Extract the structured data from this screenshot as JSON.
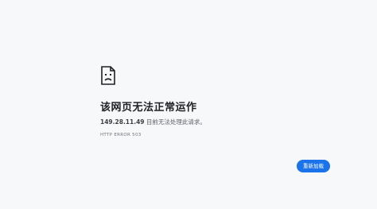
{
  "error_page": {
    "icon": "sad-document-icon",
    "title": "该网页无法正常运作",
    "host": "149.28.11.49",
    "message": " 目前无法处理此请求。",
    "error_code": "HTTP ERROR 503",
    "reload_label": "重新加载"
  },
  "colors": {
    "background": "#f7f8fa",
    "button": "#1a73e8",
    "text": "#202124"
  }
}
